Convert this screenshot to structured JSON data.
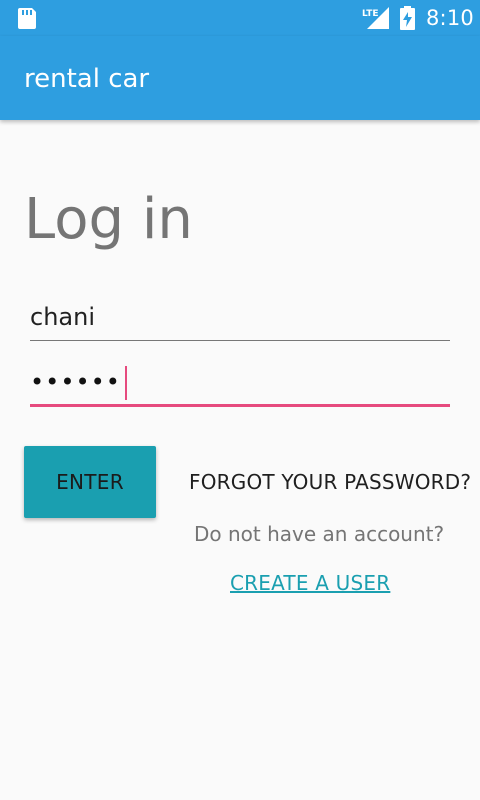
{
  "status_bar": {
    "time": "8:10",
    "network_label": "LTE",
    "icons": [
      "sd-card-icon",
      "lte-signal-icon",
      "battery-charging-icon"
    ]
  },
  "app_bar": {
    "title": "rental car"
  },
  "login": {
    "title": "Log in",
    "username_value": "chani",
    "password_mask": "••••••",
    "enter_label": "ENTER",
    "forgot_label": "FORGOT YOUR PASSWORD?",
    "no_account_text": "Do not have an account?",
    "create_user_label": "CREATE A USER"
  },
  "colors": {
    "primary": "#2e9ee0",
    "accent": "#e64a7e",
    "button": "#1a9fb0",
    "background": "#fafafa"
  }
}
